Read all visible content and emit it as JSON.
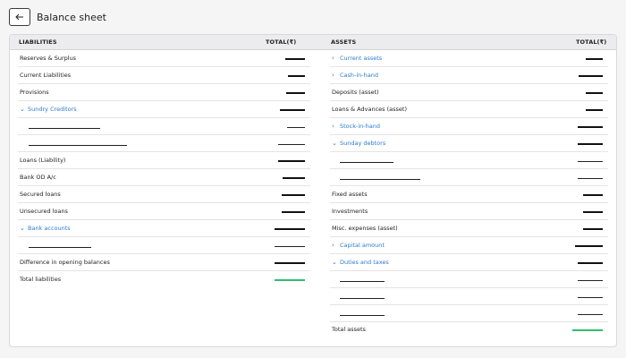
{
  "header": {
    "title": "Balance sheet"
  },
  "columns": {
    "liabilities": "LIABILITIES",
    "liabilities_total": "TOTAL(₹)",
    "assets": "ASSETS",
    "assets_total": "TOTAL(₹)"
  },
  "liabilities": {
    "reserves": "Reserves & Surplus",
    "current": "Current Liabilities",
    "provisions": "Provisions",
    "sundry_creditors": "Sundry Creditors",
    "loans": "Loans (Liability)",
    "bank_od": "Bank OD A/c",
    "secured": "Secured loans",
    "unsecured": "Unsecured loans",
    "bank_accounts": "Bank accounts",
    "difference": "Difference in opening balances",
    "total": "Total liabilities"
  },
  "assets": {
    "current_assets": "Current assets",
    "cash_in_hand": "Cash-in-hand",
    "deposits": "Deposits (asset)",
    "loans_advances": "Loans & Advances (asset)",
    "stock_in_hand": "Stock-in-hand",
    "sunday_debtors": "Sunday debtors",
    "fixed": "Fixed assets",
    "investments": "Investments",
    "misc": "Misc. expenses (asset)",
    "capital": "Capital amount",
    "duties": "Duties and taxes",
    "total": "Total assets"
  },
  "icons": {
    "back": "arrow-left-icon",
    "expand": "chevron-right-icon",
    "collapse": "chevron-down-icon"
  },
  "colors": {
    "link": "#2b7bd0",
    "total_bar": "#2dbd6e"
  }
}
